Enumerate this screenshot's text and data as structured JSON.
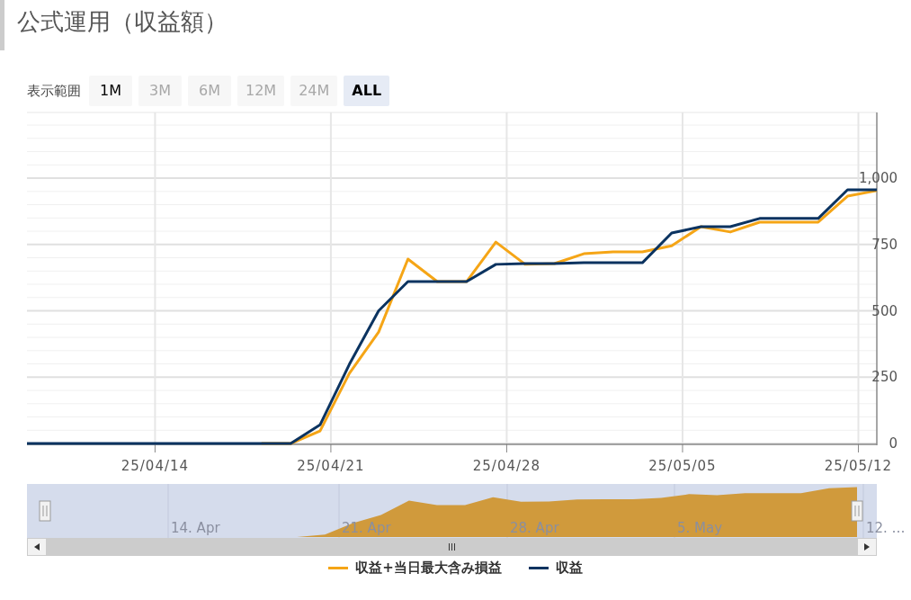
{
  "title": "公式運用（収益額）",
  "range_selector": {
    "label": "表示範囲",
    "buttons": [
      {
        "label": "1M",
        "selected": false,
        "disabled": false
      },
      {
        "label": "3M",
        "selected": false,
        "disabled": true
      },
      {
        "label": "6M",
        "selected": false,
        "disabled": true
      },
      {
        "label": "12M",
        "selected": false,
        "disabled": true
      },
      {
        "label": "24M",
        "selected": false,
        "disabled": true
      },
      {
        "label": "ALL",
        "selected": true,
        "disabled": false
      }
    ]
  },
  "chart": {
    "chart_data": {
      "type": "line",
      "ylim": [
        0,
        1200
      ],
      "grid": true,
      "categories": [
        null,
        null,
        null,
        null,
        "25/04/14",
        null,
        null,
        null,
        null,
        null,
        "25/04/21",
        null,
        null,
        null,
        null,
        null,
        "25/04/28",
        null,
        null,
        null,
        null,
        null,
        "25/05/05",
        null,
        null,
        null,
        null,
        null,
        "25/05/12",
        null
      ],
      "yticks": [
        {
          "value": 0,
          "label": "0"
        },
        {
          "value": 250,
          "label": "250"
        },
        {
          "value": 500,
          "label": "500"
        },
        {
          "value": 750,
          "label": "750"
        },
        {
          "value": 1000,
          "label": "1,000"
        }
      ],
      "series": [
        {
          "name": "収益+当日最大含み損益",
          "color": "#f5a516",
          "values": [
            null,
            null,
            null,
            null,
            null,
            null,
            null,
            null,
            0,
            0,
            47,
            264,
            420,
            695,
            610,
            610,
            759,
            675,
            678,
            715,
            722,
            722,
            745,
            817,
            797,
            834,
            834,
            834,
            932,
            953
          ]
        },
        {
          "name": "収益",
          "color": "#0b3360",
          "values": [
            0,
            0,
            0,
            0,
            0,
            0,
            0,
            0,
            0,
            0,
            70,
            298,
            500,
            610,
            610,
            610,
            675,
            678,
            678,
            681,
            681,
            681,
            793,
            817,
            817,
            848,
            848,
            848,
            956,
            956
          ]
        }
      ]
    }
  },
  "navigator": {
    "labels": [
      "14. Apr",
      "21. Apr",
      "28. Apr",
      "5. May",
      "12. …"
    ]
  },
  "scrollbar": {
    "grip": "III"
  }
}
